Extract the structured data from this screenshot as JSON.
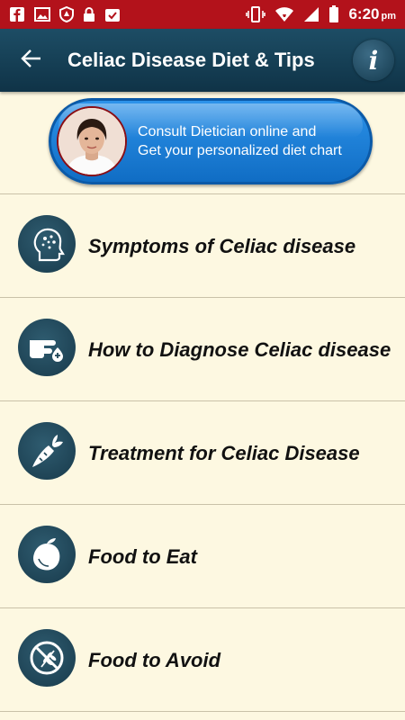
{
  "status_bar": {
    "time": "6:20",
    "ampm": "pm",
    "left_icons": [
      "facebook-icon",
      "gallery-icon",
      "shield-icon",
      "lock-icon",
      "check-icon"
    ],
    "right_icons": [
      "vibrate-icon",
      "wifi-icon",
      "signal-icon",
      "battery-icon"
    ]
  },
  "app_bar": {
    "title": "Celiac Disease Diet & Tips",
    "back_icon": "back-arrow-icon",
    "info_icon": "info-icon",
    "info_glyph": "i"
  },
  "banner": {
    "line1": "Consult Dietician online and",
    "line2": "Get your personalized diet chart"
  },
  "menu": [
    {
      "label": "Symptoms of Celiac disease",
      "icon": "head-symptoms-icon"
    },
    {
      "label": "How to Diagnose Celiac disease",
      "icon": "finger-blood-drop-icon"
    },
    {
      "label": "Treatment for Celiac Disease",
      "icon": "carrot-icon"
    },
    {
      "label": "Food to Eat",
      "icon": "mango-icon"
    },
    {
      "label": "Food to Avoid",
      "icon": "no-wheat-icon"
    }
  ],
  "colors": {
    "status_bar": "#b3121b",
    "app_bar": "#133e55",
    "background": "#fdf8e1",
    "banner_blue": "#1b7fd8",
    "icon_circle": "#1f4557"
  }
}
